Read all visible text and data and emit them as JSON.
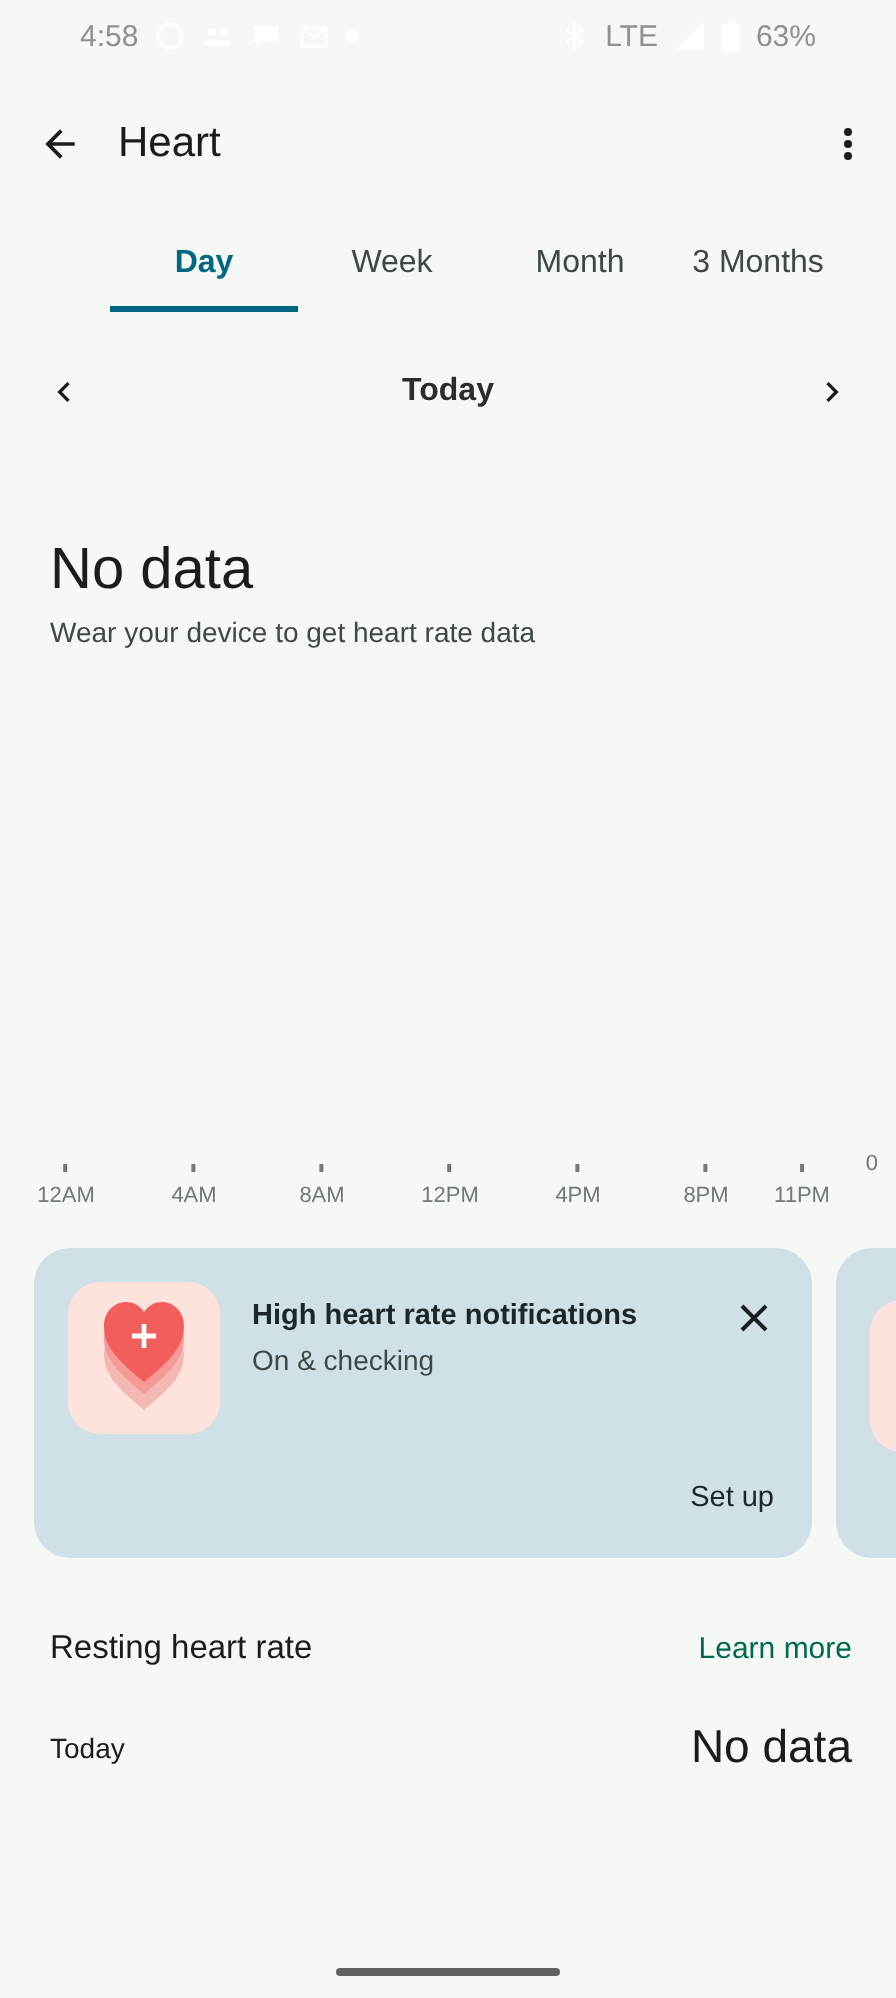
{
  "status_bar": {
    "time": "4:58",
    "network": "LTE",
    "battery": "63%"
  },
  "app_bar": {
    "title": "Heart"
  },
  "tabs": [
    {
      "label": "Day",
      "selected": true
    },
    {
      "label": "Week",
      "selected": false
    },
    {
      "label": "Month",
      "selected": false
    },
    {
      "label": "3 Months",
      "selected": false
    }
  ],
  "date_nav": {
    "label": "Today"
  },
  "summary": {
    "value": "No data",
    "message": "Wear your device to get heart rate data"
  },
  "chart_axis": {
    "x_labels": [
      "12AM",
      "4AM",
      "8AM",
      "12PM",
      "4PM",
      "8PM",
      "11PM"
    ],
    "y_label": "0"
  },
  "cards": [
    {
      "title": "High heart rate notifications",
      "subtitle": "On & checking",
      "action": "Set up"
    }
  ],
  "resting": {
    "title": "Resting heart rate",
    "link": "Learn more",
    "rows": [
      {
        "label": "Today",
        "value": "No data"
      }
    ]
  }
}
